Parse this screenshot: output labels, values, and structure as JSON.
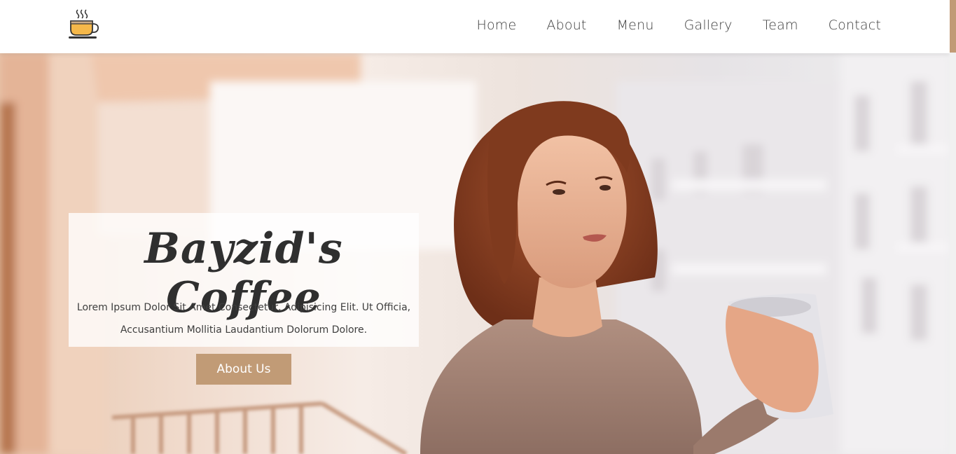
{
  "header": {
    "logo_icon": "coffee-cup-icon",
    "nav": [
      {
        "label": "Home"
      },
      {
        "label": "About"
      },
      {
        "label": "Menu"
      },
      {
        "label": "Gallery"
      },
      {
        "label": "Team"
      },
      {
        "label": "Contact"
      }
    ]
  },
  "hero": {
    "title": "Bayzid's Coffee",
    "subtitle_line1": "Lorem Ipsum Dolor Sit Amet Consectetur, Adipisicing Elit. Ut Officia,",
    "subtitle_line2": "Accusantium Mollitia Laudantium Dolorum Dolore.",
    "button_label": "About Us",
    "image": "woman-holding-coffee-cup-on-balcony"
  },
  "colors": {
    "accent": "#c19b76",
    "text_dark": "#2f2f2f",
    "nav_text": "#3d3d3d"
  }
}
